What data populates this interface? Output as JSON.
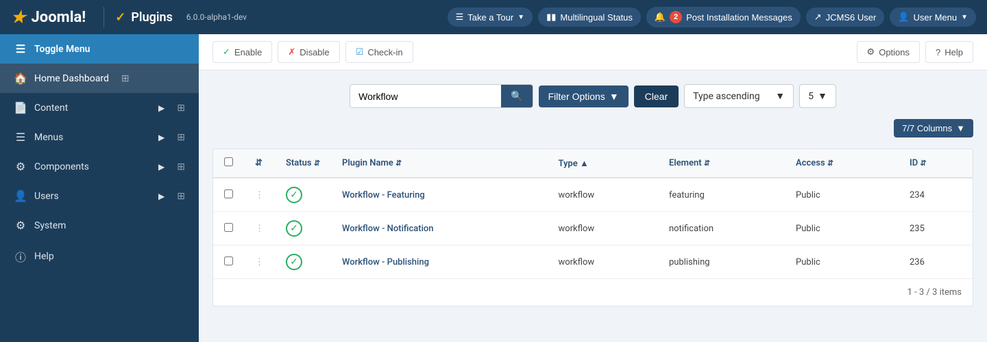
{
  "topbar": {
    "logo_text": "Joomla!",
    "page_title": "Plugins",
    "version": "6.0.0-alpha1-dev",
    "tour_label": "Take a Tour",
    "multilingual_label": "Multilingual Status",
    "notifications_count": "2",
    "post_install_label": "Post Installation Messages",
    "jcms_user_label": "JCMS6 User",
    "user_menu_label": "User Menu"
  },
  "sidebar": {
    "toggle_label": "Toggle Menu",
    "items": [
      {
        "id": "home-dashboard",
        "label": "Home Dashboard",
        "icon": "🏠"
      },
      {
        "id": "content",
        "label": "Content",
        "icon": "📄",
        "has_arrow": true
      },
      {
        "id": "menus",
        "label": "Menus",
        "icon": "☰",
        "has_arrow": true
      },
      {
        "id": "components",
        "label": "Components",
        "icon": "🧩",
        "has_arrow": true
      },
      {
        "id": "users",
        "label": "Users",
        "icon": "👤",
        "has_arrow": true
      },
      {
        "id": "system",
        "label": "System",
        "icon": "⚙"
      },
      {
        "id": "help",
        "label": "Help",
        "icon": "ℹ"
      }
    ]
  },
  "toolbar": {
    "enable_label": "Enable",
    "disable_label": "Disable",
    "checkin_label": "Check-in",
    "options_label": "Options",
    "help_label": "Help"
  },
  "filter": {
    "search_value": "Workflow",
    "search_placeholder": "Search",
    "filter_options_label": "Filter Options",
    "clear_label": "Clear",
    "sort_label": "Type ascending",
    "per_page_value": "5",
    "columns_label": "7/7 Columns"
  },
  "table": {
    "columns": [
      {
        "id": "status",
        "label": "Status",
        "sortable": true
      },
      {
        "id": "plugin-name",
        "label": "Plugin Name",
        "sortable": true
      },
      {
        "id": "type",
        "label": "Type",
        "sortable": true
      },
      {
        "id": "element",
        "label": "Element",
        "sortable": true
      },
      {
        "id": "access",
        "label": "Access",
        "sortable": true
      },
      {
        "id": "id",
        "label": "ID",
        "sortable": true
      }
    ],
    "rows": [
      {
        "id": 234,
        "status": "enabled",
        "name": "Workflow - Featuring",
        "type": "workflow",
        "element": "featuring",
        "access": "Public"
      },
      {
        "id": 235,
        "status": "enabled",
        "name": "Workflow - Notification",
        "type": "workflow",
        "element": "notification",
        "access": "Public"
      },
      {
        "id": 236,
        "status": "enabled",
        "name": "Workflow - Publishing",
        "type": "workflow",
        "element": "publishing",
        "access": "Public"
      }
    ],
    "pagination": "1 - 3 / 3 items"
  }
}
